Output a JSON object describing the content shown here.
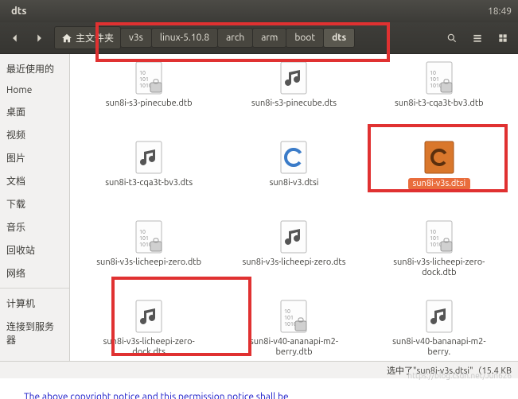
{
  "titlebar": {
    "title": "dts",
    "time": "18:49"
  },
  "breadcrumb": {
    "home": "主文件夹",
    "items": [
      "v3s",
      "linux-5.10.8",
      "arch",
      "arm",
      "boot",
      "dts"
    ]
  },
  "sidebar": {
    "recent": "最近使用的",
    "home": "Home",
    "desktop": "桌面",
    "videos": "视频",
    "pictures": "图片",
    "documents": "文档",
    "downloads": "下载",
    "music": "音乐",
    "trash": "回收站",
    "network": "网络",
    "computer": "计算机",
    "connect": "连接到服务器"
  },
  "files": [
    {
      "name": "sun8i-s3-pinecube.dtb",
      "icon": "bin"
    },
    {
      "name": "sun8i-s3-pinecube.dts",
      "icon": "music"
    },
    {
      "name": "sun8i-t3-cqa3t-bv3.dtb",
      "icon": "bin"
    },
    {
      "name": "sun8i-t3-cqa3t-bv3.dts",
      "icon": "music"
    },
    {
      "name": "sun8i-v3.dtsi",
      "icon": "c"
    },
    {
      "name": "sun8i-v3s.dtsi",
      "icon": "csel",
      "selected": true
    },
    {
      "name": "sun8i-v3s-licheepi-zero.dtb",
      "icon": "bin"
    },
    {
      "name": "sun8i-v3s-licheepi-zero.dts",
      "icon": "music"
    },
    {
      "name": "sun8i-v3s-licheepi-zero-dock.dtb",
      "icon": "bin"
    },
    {
      "name": "sun8i-v3s-licheepi-zero-dock.dts",
      "icon": "music"
    },
    {
      "name": "sun8i-v40-ananapi-m2-berry.dtb",
      "icon": "bin"
    },
    {
      "name": "sun8i-v40-bananapi-m2-berry.",
      "icon": "music"
    }
  ],
  "statusbar": {
    "text": "选中了\"sun8i-v3s.dtsi\"（15.4 KB"
  },
  "footer": {
    "line1": "  The above copyright notice and this permission notice shall be"
  },
  "watermark": "https://blog.csdn.net/Jun626"
}
